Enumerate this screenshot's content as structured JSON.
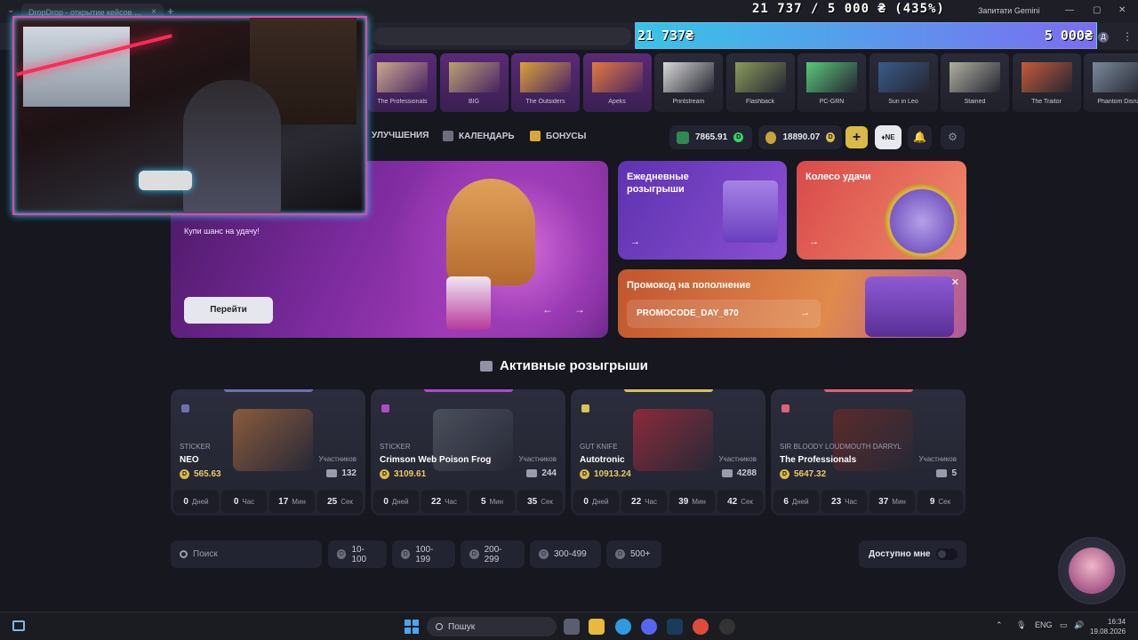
{
  "browser": {
    "tab_title": "DropDrop - открытие кейсов ...",
    "tab_close": "×",
    "new_tab": "+",
    "tab_menu": "⌄",
    "gemini_label": "Запитати Gemini",
    "minimize": "—",
    "maximize": "▢",
    "close": "✕",
    "profile_initial": "Д",
    "menu": "⋮"
  },
  "stream_overlay": {
    "goal_text": "21 737 / 5 000 ₴ (435%)",
    "bar_left": "21 737₴",
    "bar_right": "5 000₴",
    "progress_percent": 435
  },
  "cases": [
    {
      "name": "The Professionals",
      "style": "purple"
    },
    {
      "name": "BIG",
      "style": "purple"
    },
    {
      "name": "The Outsiders",
      "style": "purple"
    },
    {
      "name": "Apeks",
      "style": "purple"
    },
    {
      "name": "Printstream",
      "style": "dark"
    },
    {
      "name": "Flashback",
      "style": "dark"
    },
    {
      "name": "PC-GRN",
      "style": "dark"
    },
    {
      "name": "Sun in Leo",
      "style": "dark"
    },
    {
      "name": "Stained",
      "style": "dark"
    },
    {
      "name": "The Traitor",
      "style": "dark"
    },
    {
      "name": "Phantom Disru",
      "style": "dark"
    }
  ],
  "nav": {
    "upgrades": "УЛУЧШЕНИЯ",
    "calendar": "КАЛЕНДАРЬ",
    "bonuses": "БОНУСЫ"
  },
  "balances": {
    "green": "7865.91",
    "gold": "18890.07",
    "coin_mark": "D",
    "plus": "+",
    "ne_badge": "♦NE",
    "bell": "🔔",
    "settings": "⚙"
  },
  "hero": {
    "subtitle": "Купи шанс на удачу!",
    "button": "Перейти",
    "prev": "←",
    "next": "→"
  },
  "daily": {
    "title_line1": "Ежедневные",
    "title_line2": "розыгрыши",
    "arrow": "→"
  },
  "wheel": {
    "title": "Колесо удачи",
    "arrow": "→"
  },
  "promo": {
    "title": "Промокод на пополнение",
    "code": "PROMOCODE_DAY_870",
    "go": "→",
    "close": "✕"
  },
  "giveaways": {
    "title": "Активные розыгрыши",
    "participants_label": "Участников",
    "units": {
      "days": "Дней",
      "hours": "Час",
      "minutes": "Мин",
      "seconds": "Сек"
    },
    "items": [
      {
        "type": "STICKER",
        "name": "NEO",
        "price": "565.63",
        "participants": "132",
        "days": "0",
        "hours": "0",
        "minutes": "17",
        "seconds": "25",
        "accent": "#6f6fb0",
        "img": "#8a5a3c"
      },
      {
        "type": "STICKER",
        "name": "Crimson Web Poison Frog",
        "price": "3109.61",
        "participants": "244",
        "days": "0",
        "hours": "22",
        "minutes": "5",
        "seconds": "35",
        "accent": "#b04ac8",
        "img": "#4a4f5c"
      },
      {
        "type": "GUT KNIFE",
        "name": "Autotronic",
        "price": "10913.24",
        "participants": "4288",
        "days": "0",
        "hours": "22",
        "minutes": "39",
        "seconds": "42",
        "accent": "#d8c25a",
        "img": "#8a2a3a"
      },
      {
        "type": "SIR BLOODY LOUDMOUTH DARRYL",
        "name": "The Professionals",
        "price": "5647.32",
        "participants": "5",
        "days": "6",
        "hours": "23",
        "minutes": "37",
        "seconds": "9",
        "accent": "#e0607a",
        "img": "#5a2a2a"
      }
    ]
  },
  "filters": {
    "search_placeholder": "Поиск",
    "ranges": [
      "10-100",
      "100-199",
      "200-299",
      "300-499",
      "500+"
    ],
    "available_label": "Доступно мне",
    "available_on": false
  },
  "taskbar": {
    "search": "Пошук",
    "lang": "ENG",
    "time": "16:34",
    "date": "19.08.2026",
    "tray_up": "⌃"
  }
}
